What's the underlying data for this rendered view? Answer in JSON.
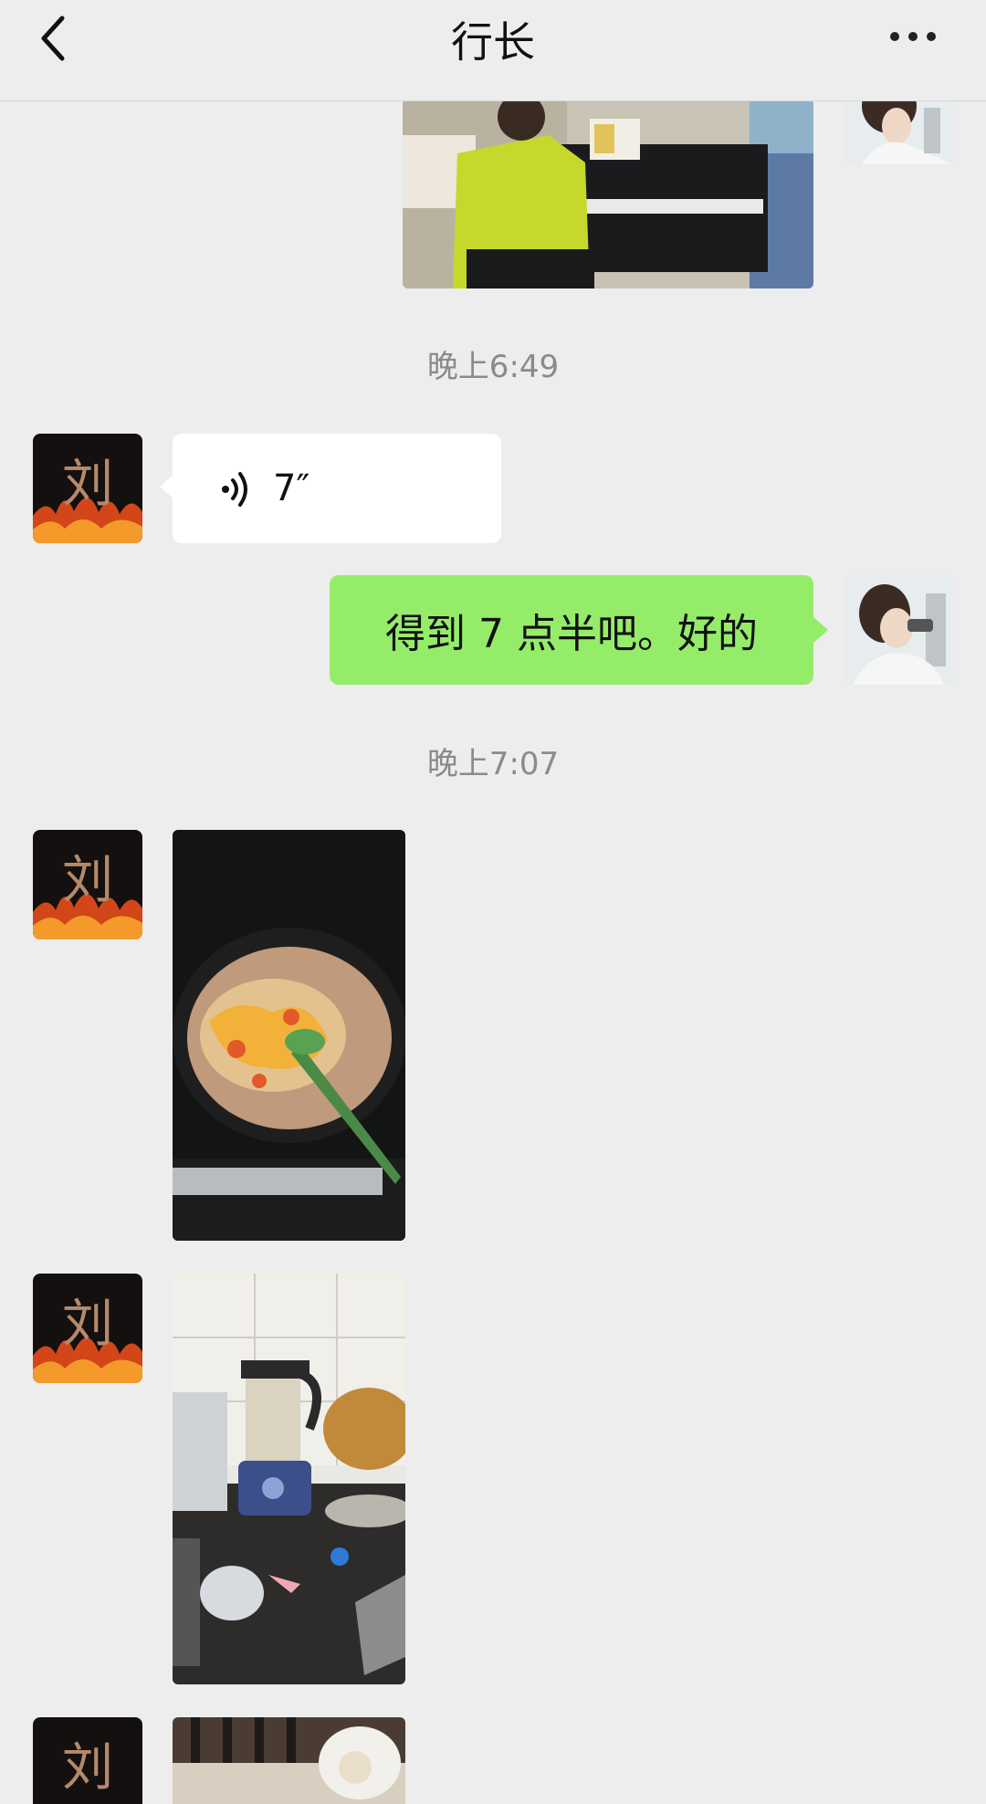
{
  "header": {
    "title": "行长"
  },
  "timestamps": [
    "晚上6:49",
    "晚上7:07"
  ],
  "messages": {
    "voice_duration": "7″",
    "sent_text": "得到 7 点半吧。好的"
  },
  "avatar_glyph": "刘",
  "icons": [
    "chevron-left-icon",
    "more-icon",
    "voice-icon"
  ],
  "colors": {
    "background": "#ededed",
    "sent_bubble": "#95ec69",
    "received_bubble": "#ffffff"
  }
}
